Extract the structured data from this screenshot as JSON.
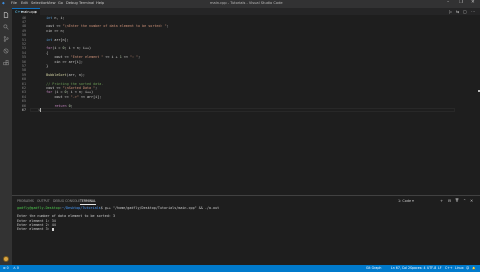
{
  "titlebar": {
    "menus": [
      "File",
      "Edit",
      "Selection",
      "View",
      "Go",
      "Debug",
      "Terminal",
      "Help"
    ],
    "title": "main.cpp - Tutorials - Visual Studio Code",
    "controls": [
      "–",
      "❐",
      "✕"
    ]
  },
  "activity_bar": {
    "icons": [
      "files-icon",
      "search-icon",
      "source-control-icon",
      "debug-icon",
      "extensions-icon"
    ]
  },
  "tab": {
    "icon_text": "C++",
    "label": "main.cpp",
    "close": "×"
  },
  "editor_actions": [
    "▷",
    "⇆",
    "▢",
    "⋯"
  ],
  "editor": {
    "line_numbers": [
      "46",
      "47",
      "48",
      "49",
      "50",
      "51",
      "52",
      "53",
      "54",
      "55",
      "56",
      "57",
      "58",
      "59",
      "60",
      "61",
      "62",
      "63",
      "64",
      "65",
      "66",
      "67"
    ],
    "current_line_index": 21,
    "lines": [
      [
        {
          "t": "    ",
          "c": "d4d4d4"
        },
        {
          "t": "int",
          "c": "569cd6"
        },
        {
          "t": " n, i;",
          "c": "d4d4d4"
        }
      ],
      [],
      [
        {
          "t": "    cout << ",
          "c": "d4d4d4"
        },
        {
          "t": "\"\\nEnter the number of data element to be sorted: \"",
          "c": "ce9178"
        },
        {
          "t": ";",
          "c": "d4d4d4"
        }
      ],
      [
        {
          "t": "    cin >> n;",
          "c": "d4d4d4"
        }
      ],
      [],
      [
        {
          "t": "    ",
          "c": "d4d4d4"
        },
        {
          "t": "int",
          "c": "569cd6"
        },
        {
          "t": " arr[n];",
          "c": "d4d4d4"
        }
      ],
      [],
      [
        {
          "t": "    ",
          "c": "d4d4d4"
        },
        {
          "t": "for",
          "c": "c586c0"
        },
        {
          "t": "(i = ",
          "c": "d4d4d4"
        },
        {
          "t": "0",
          "c": "b5cea8"
        },
        {
          "t": "; i < n; i++)",
          "c": "d4d4d4"
        }
      ],
      [
        {
          "t": "    {",
          "c": "d4d4d4"
        }
      ],
      [
        {
          "t": "        cout << ",
          "c": "d4d4d4"
        },
        {
          "t": "\"Enter element \"",
          "c": "ce9178"
        },
        {
          "t": " << i + ",
          "c": "d4d4d4"
        },
        {
          "t": "1",
          "c": "b5cea8"
        },
        {
          "t": " << ",
          "c": "d4d4d4"
        },
        {
          "t": "\": \"",
          "c": "ce9178"
        },
        {
          "t": ";",
          "c": "d4d4d4"
        }
      ],
      [
        {
          "t": "        cin >> arr[i];",
          "c": "d4d4d4"
        }
      ],
      [
        {
          "t": "    }",
          "c": "d4d4d4"
        }
      ],
      [],
      [
        {
          "t": "    ",
          "c": "d4d4d4"
        },
        {
          "t": "BubbleSort",
          "c": "dcdcaa"
        },
        {
          "t": "(arr, n);",
          "c": "d4d4d4"
        }
      ],
      [],
      [
        {
          "t": "    ",
          "c": "d4d4d4"
        },
        {
          "t": "// Printing the sorted data.",
          "c": "6a9955"
        }
      ],
      [
        {
          "t": "    cout << ",
          "c": "d4d4d4"
        },
        {
          "t": "\"\\nSorted Data \"",
          "c": "ce9178"
        },
        {
          "t": ";",
          "c": "d4d4d4"
        }
      ],
      [
        {
          "t": "    ",
          "c": "d4d4d4"
        },
        {
          "t": "for",
          "c": "c586c0"
        },
        {
          "t": " (i = ",
          "c": "d4d4d4"
        },
        {
          "t": "0",
          "c": "b5cea8"
        },
        {
          "t": "; i < n; i++)",
          "c": "d4d4d4"
        }
      ],
      [
        {
          "t": "        cout << ",
          "c": "d4d4d4"
        },
        {
          "t": "\"->\"",
          "c": "ce9178"
        },
        {
          "t": " << arr[i];",
          "c": "d4d4d4"
        }
      ],
      [],
      [
        {
          "t": "        ",
          "c": "d4d4d4"
        },
        {
          "t": "return",
          "c": "c586c0"
        },
        {
          "t": " ",
          "c": "d4d4d4"
        },
        {
          "t": "0",
          "c": "b5cea8"
        },
        {
          "t": ";",
          "c": "d4d4d4"
        }
      ],
      [
        {
          "t": "}",
          "c": "d4d4d4"
        }
      ]
    ]
  },
  "panel": {
    "tabs": [
      "PROBLEMS",
      "OUTPUT",
      "DEBUG CONSOLE",
      "TERMINAL"
    ],
    "active_tab": "TERMINAL",
    "terminal_select": "1: Code",
    "controls": [
      "+",
      "⊟",
      "🗑",
      "⌃",
      "✕"
    ],
    "terminal_lines": [
      [
        {
          "t": "gadfly@gadfly-Desktop",
          "c": "4ec94e"
        },
        {
          "t": ":",
          "c": "cccccc"
        },
        {
          "t": "~/Desktop/Tutorials",
          "c": "4a9eff"
        },
        {
          "t": "$ g++ \"/home/gadfly/Desktop/Tutorials/main.cpp\" && ./a.out",
          "c": "cccccc"
        }
      ],
      [],
      [
        {
          "t": "Enter the number of data element to be sorted: 3",
          "c": "cccccc"
        }
      ],
      [
        {
          "t": "Enter element 1: 34",
          "c": "cccccc"
        }
      ],
      [
        {
          "t": "Enter element 2: 44",
          "c": "cccccc"
        }
      ],
      [
        {
          "t": "Enter element 3: ",
          "c": "cccccc"
        }
      ]
    ]
  },
  "statusbar": {
    "errors": "⊗ 0",
    "warnings": "⚠ 0",
    "git": "Git Graph",
    "position": "Ln 67, Col 2",
    "spaces": "Spaces: 4",
    "encoding": "UTF-8",
    "eol": "LF",
    "language": "C++",
    "os": "Linux",
    "feedback": "☺",
    "bell": "🔔"
  }
}
